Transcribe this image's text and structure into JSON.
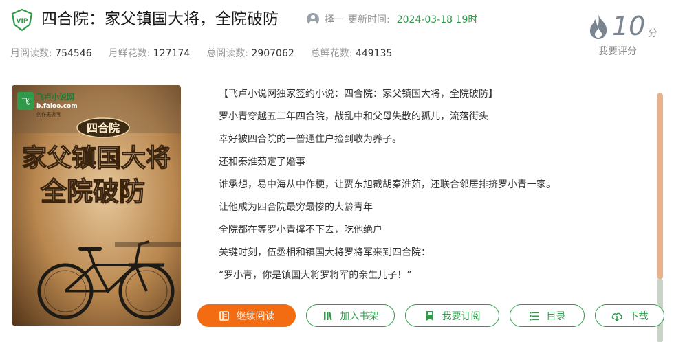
{
  "book": {
    "title": "四合院：家父镇国大将，全院破防",
    "author": "择一",
    "update_label": "更新时间:",
    "update_time": "2024-03-18 19时"
  },
  "vip_badge": {
    "icon": "vip-shield-icon",
    "text": "VIP",
    "color": "#2e9a4a"
  },
  "stats": [
    {
      "label": "月阅读数:",
      "value": "754546"
    },
    {
      "label": "月鲜花数:",
      "value": "127174"
    },
    {
      "label": "总阅读数:",
      "value": "2907062"
    },
    {
      "label": "总鲜花数:",
      "value": "449135"
    }
  ],
  "rating": {
    "score": "10",
    "unit": "分",
    "button_label": "我要评分",
    "icon": "flame-icon"
  },
  "cover": {
    "publisher_logo": "飞卢小说网",
    "publisher_url": "b.faloo.com",
    "publisher_tagline": "创作无极限",
    "series": "四合院",
    "title_line1": "家父镇国大将",
    "title_line2": "全院破防"
  },
  "description": [
    "【飞卢小说网独家签约小说：四合院：家父镇国大将，全院破防】",
    "罗小青穿越五二年四合院，战乱中和父母失散的孤儿，流落街头",
    "幸好被四合院的一普通住户捡到收为养子。",
    "还和秦淮茹定了婚事",
    "谁承想，易中海从中作梗，让贾东旭截胡秦淮茹，还联合邻居排挤罗小青一家。",
    "让他成为四合院最穷最惨的大龄青年",
    "全院都在等罗小青撑不下去，吃他绝户",
    "关键时刻，伍丞相和镇国大将罗将军来到四合院：",
    "“罗小青，你是镇国大将罗将军的亲生儿子！”"
  ],
  "actions": {
    "continue_reading": "继续阅读",
    "add_shelf": "加入书架",
    "subscribe": "我要订阅",
    "catalog": "目录",
    "download": "下载"
  },
  "colors": {
    "accent_green": "#2e9a4a",
    "primary_orange": "#f36c12"
  }
}
